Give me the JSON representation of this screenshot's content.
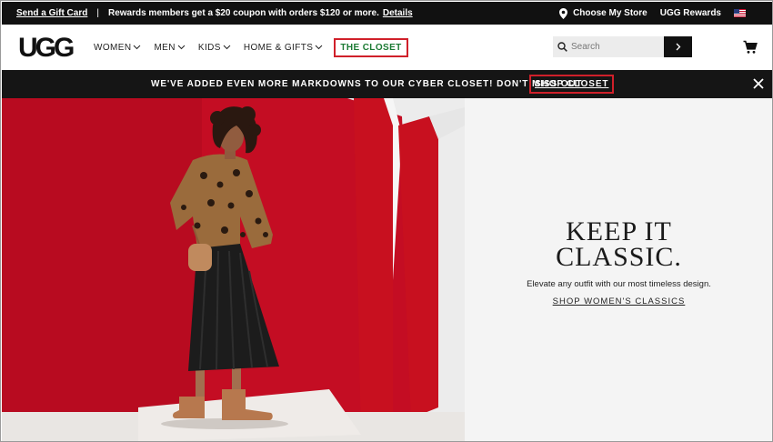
{
  "topbar": {
    "gift_card_link": "Send a Gift Card",
    "separator": "|",
    "promo_text": "Rewards members get a $20 coupon with orders $120 or more.",
    "promo_link": "Details",
    "store_label": "Choose My Store",
    "rewards_label": "UGG Rewards",
    "flag_icon": "us-flag-icon"
  },
  "header": {
    "logo_text": "UGG",
    "nav": [
      {
        "label": "WOMEN"
      },
      {
        "label": "MEN"
      },
      {
        "label": "KIDS"
      },
      {
        "label": "HOME & GIFTS"
      }
    ],
    "closet_label": "THE CLOSET",
    "search_placeholder": "Search",
    "search_icon": "search-icon",
    "cart_icon": "shopping-cart-icon"
  },
  "announcement": {
    "text": "WE'VE ADDED EVEN MORE MARKDOWNS TO OUR CYBER CLOSET! DON'T MISS OUT",
    "link": "SHOP CLOSET",
    "close_icon": "close-icon"
  },
  "hero": {
    "title_line1": "KEEP IT",
    "title_line2": "CLASSIC.",
    "subtitle": "Elevate any outfit with our most timeless design.",
    "cta": "SHOP WOMEN'S CLASSICS"
  },
  "colors": {
    "black": "#111111",
    "highlight_border": "#d0202a",
    "closet_green": "#1b7a33",
    "hero_red": "#c40d23",
    "hero_panel": "#f4f4f4"
  }
}
